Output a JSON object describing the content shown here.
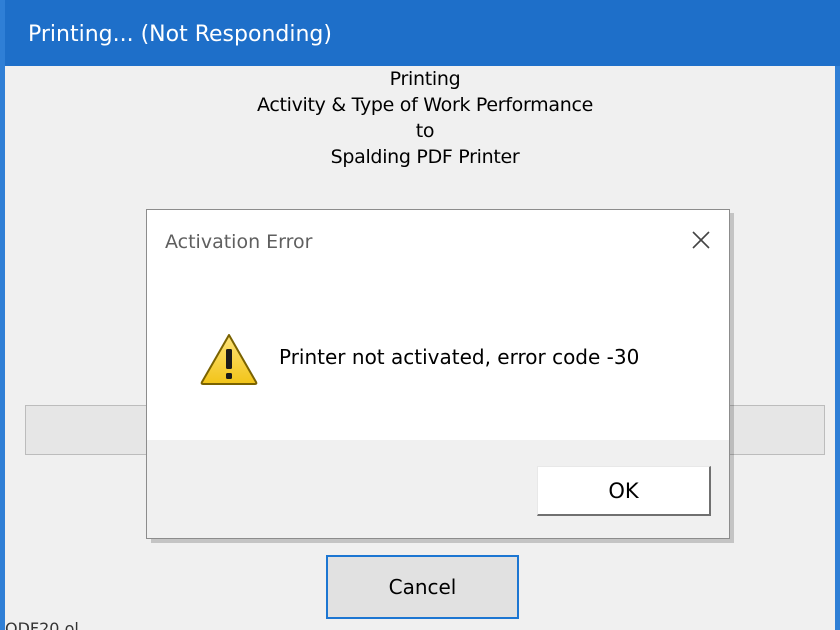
{
  "printing_window": {
    "title": "Printing... (Not Responding)",
    "lines": [
      "Printing",
      "Activity & Type of Work Performance",
      "to",
      "Spalding PDF Printer"
    ],
    "progress": 0,
    "cancel_label": "Cancel",
    "bottom_fragment": "ODF20 ol"
  },
  "error_dialog": {
    "title": "Activation Error",
    "close_icon": "close-icon",
    "warning_icon": "warning-icon",
    "message": "Printer not activated, error code -30",
    "ok_label": "OK"
  },
  "colors": {
    "titlebar": "#1e6fc9",
    "window_border": "#2f7fd6",
    "warning_yellow": "#f2c418",
    "focus_blue": "#1c76d2"
  }
}
